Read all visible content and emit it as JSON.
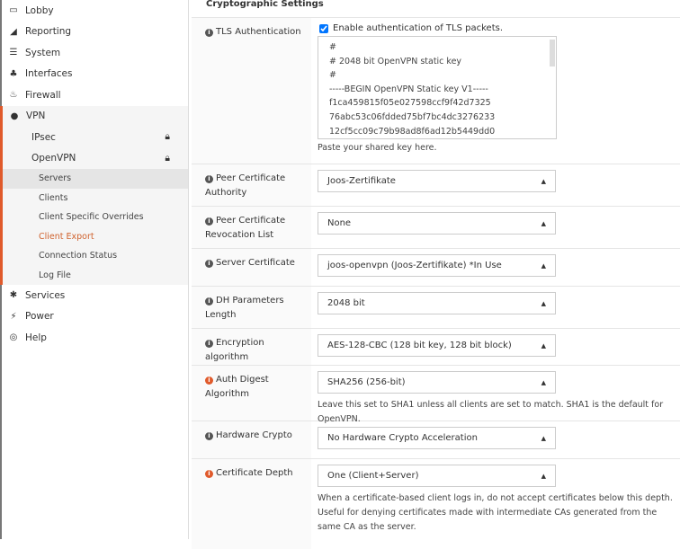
{
  "sidebar": {
    "items": [
      {
        "label": "Lobby",
        "icon": "laptop-icon"
      },
      {
        "label": "Reporting",
        "icon": "area-chart-icon"
      },
      {
        "label": "System",
        "icon": "server-icon"
      },
      {
        "label": "Interfaces",
        "icon": "sitemap-icon"
      },
      {
        "label": "Firewall",
        "icon": "fire-icon"
      }
    ],
    "vpn": "VPN",
    "ipsec": "IPsec",
    "openvpn": "OpenVPN",
    "openvpn_items": [
      "Servers",
      "Clients",
      "Client Specific Overrides",
      "Client Export",
      "Connection Status",
      "Log File"
    ],
    "bottom": [
      {
        "label": "Services",
        "icon": "gear-icon"
      },
      {
        "label": "Power",
        "icon": "plug-icon"
      },
      {
        "label": "Help",
        "icon": "lifebuoy-icon"
      }
    ]
  },
  "main": {
    "section_title": "Cryptographic Settings",
    "tls": {
      "label": "TLS Authentication",
      "checkbox_label": "Enable authentication of TLS packets.",
      "checked": true,
      "key": "#\n# 2048 bit OpenVPN static key\n#\n-----BEGIN OpenVPN Static key V1-----\nf1ca459815f05e027598ccf9f42d7325\n76abc53c06fdded75bf7bc4dc3276233\n12cf5cc09c79b98ad8f6ad12b5449dd0\n",
      "help": "Paste your shared key here."
    },
    "rows": [
      {
        "label": "Peer Certificate Authority",
        "value": "Joos-Zertifikate"
      },
      {
        "label": "Peer Certificate Revocation List",
        "value": "None"
      },
      {
        "label": "Server Certificate",
        "value": "joos-openvpn (Joos-Zertifikate) *In Use"
      },
      {
        "label": "DH Parameters Length",
        "value": "2048 bit"
      },
      {
        "label": "Encryption algorithm",
        "value": "AES-128-CBC (128 bit key, 128 bit block)"
      },
      {
        "label": "Auth Digest Algorithm",
        "value": "SHA256 (256-bit)",
        "help": "Leave this set to SHA1 unless all clients are set to match. SHA1 is the default for OpenVPN."
      },
      {
        "label": "Hardware Crypto",
        "value": "No Hardware Crypto Acceleration"
      },
      {
        "label": "Certificate Depth",
        "value": "One (Client+Server)",
        "help": "When a certificate-based client logs in, do not accept certificates below this depth. Useful for denying certificates made with intermediate CAs generated from the same CA as the server."
      }
    ]
  }
}
